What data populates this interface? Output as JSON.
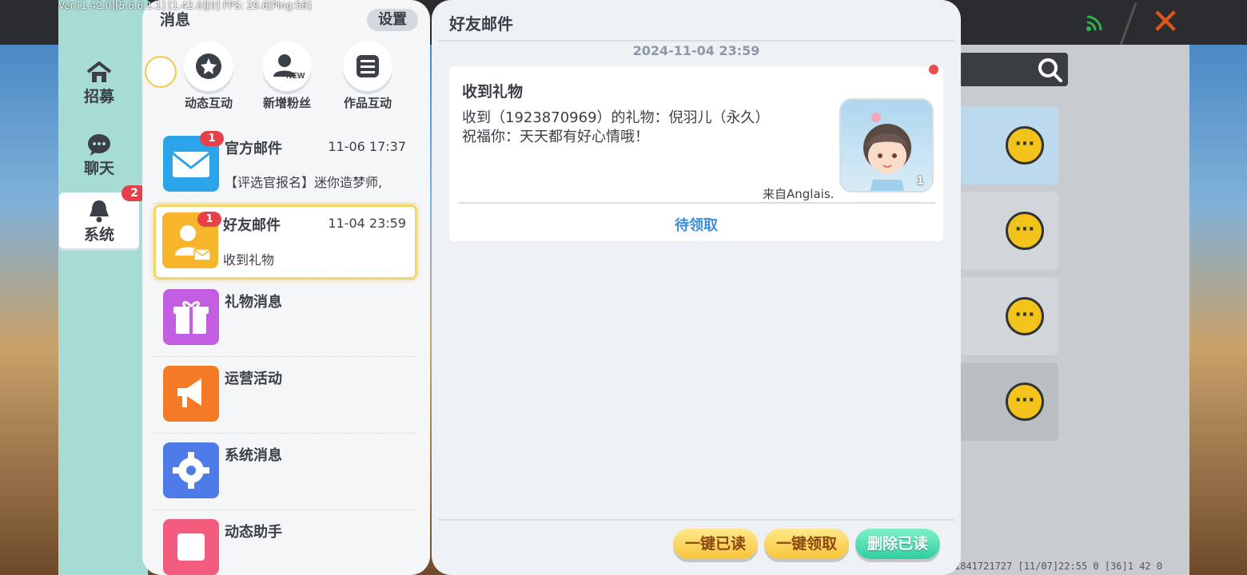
{
  "debug": "Ver:[1.42.0][5.6.6.1.1] [1.42.0][0] FPS: 29.6[Ping:58]",
  "background": {
    "status_text": "1841721727   [11/07]22:55 0   [36]1 42 0"
  },
  "nav": {
    "items": [
      {
        "label": "招募",
        "icon": "home-icon"
      },
      {
        "label": "聊天",
        "icon": "chat-bubble-icon"
      },
      {
        "label": "系统",
        "icon": "bell-icon",
        "badge": "2",
        "active": true
      }
    ]
  },
  "messages": {
    "title": "消息",
    "settings": "设置",
    "quick": [
      {
        "label": "动态互动",
        "icon": "star-icon"
      },
      {
        "label": "新增粉丝",
        "icon": "new-fan-icon",
        "tag": "NEW"
      },
      {
        "label": "作品互动",
        "icon": "list-icon"
      }
    ],
    "list": [
      {
        "name": "官方邮件",
        "time": "11-06 17:37",
        "preview": "【评选官报名】迷你造梦师,",
        "badge": "1",
        "icon": "envelope-icon",
        "color": "#2aa3e8"
      },
      {
        "name": "好友邮件",
        "time": "11-04 23:59",
        "preview": "收到礼物",
        "badge": "1",
        "icon": "friend-mail-icon",
        "color": "#f7b52c",
        "selected": true
      },
      {
        "name": "礼物消息",
        "time": "",
        "preview": "",
        "icon": "gift-icon",
        "color": "#c35ee3"
      },
      {
        "name": "运营活动",
        "time": "",
        "preview": "",
        "icon": "megaphone-icon",
        "color": "#f47a26"
      },
      {
        "name": "系统消息",
        "time": "",
        "preview": "",
        "icon": "gear-icon",
        "color": "#4f7be8"
      },
      {
        "name": "动态助手",
        "time": "",
        "preview": "",
        "icon": "assistant-icon",
        "color": "#f25b7b"
      }
    ]
  },
  "detail": {
    "title": "好友邮件",
    "date": "2024-11-04 23:59",
    "card": {
      "title": "收到礼物",
      "line1": "收到（1923870969）的礼物：倪羽儿（永久）",
      "line2": "祝福你：天天都有好心情哦！",
      "from": "来自Anglais.",
      "count": "1",
      "claim": "待领取"
    },
    "buttons": {
      "read_all": "一键已读",
      "claim_all": "一键领取",
      "delete_read": "删除已读"
    }
  }
}
